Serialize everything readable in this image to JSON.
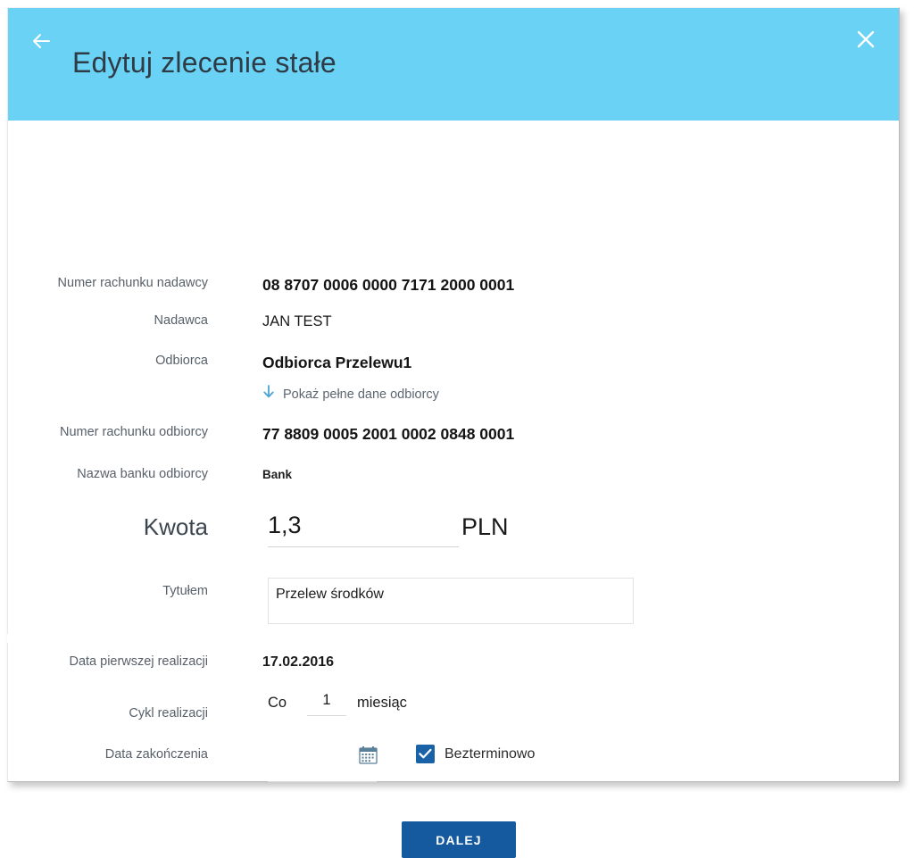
{
  "header": {
    "title": "Edytuj zlecenie stałe",
    "back_icon": "arrow-left-icon",
    "close_icon": "close-icon",
    "background_color": "#69d2f5"
  },
  "form": {
    "sender_account": {
      "label": "Numer rachunku nadawcy",
      "value": "08 8707 0006 0000 7171 2000 0001"
    },
    "sender": {
      "label": "Nadawca",
      "value": "JAN TEST"
    },
    "recipient": {
      "label": "Odbiorca",
      "value": "Odbiorca Przelewu1"
    },
    "show_full_recipient": {
      "label": "Pokaż pełne dane odbiorcy",
      "icon": "arrow-down-icon",
      "icon_color": "#4aa3d8"
    },
    "recipient_account": {
      "label": "Numer rachunku odbiorcy",
      "value": "77 8809 0005 2001 0002 0848 0001"
    },
    "recipient_bank": {
      "label": "Nazwa banku odbiorcy",
      "value": "Bank"
    },
    "amount": {
      "label": "Kwota",
      "value": "1,3",
      "placeholder": "",
      "currency": "PLN"
    },
    "title_field": {
      "label": "Tytułem",
      "value": "Przelew środków",
      "placeholder": ""
    },
    "first_execution_date": {
      "label": "Data pierwszej realizacji",
      "value": "17.02.2016"
    },
    "cycle": {
      "label": "Cykl realizacji",
      "prefix": "Co",
      "value": "1",
      "placeholder": "",
      "unit": "miesiąc"
    },
    "end_date": {
      "label": "Data zakończenia",
      "value": "",
      "placeholder": "",
      "calendar_icon": "calendar-icon"
    },
    "indefinite": {
      "label": "Bezterminowo",
      "checked": true,
      "checkbox_color": "#1a62a8"
    }
  },
  "actions": {
    "submit_label": "DALEJ",
    "submit_color": "#15599f"
  }
}
